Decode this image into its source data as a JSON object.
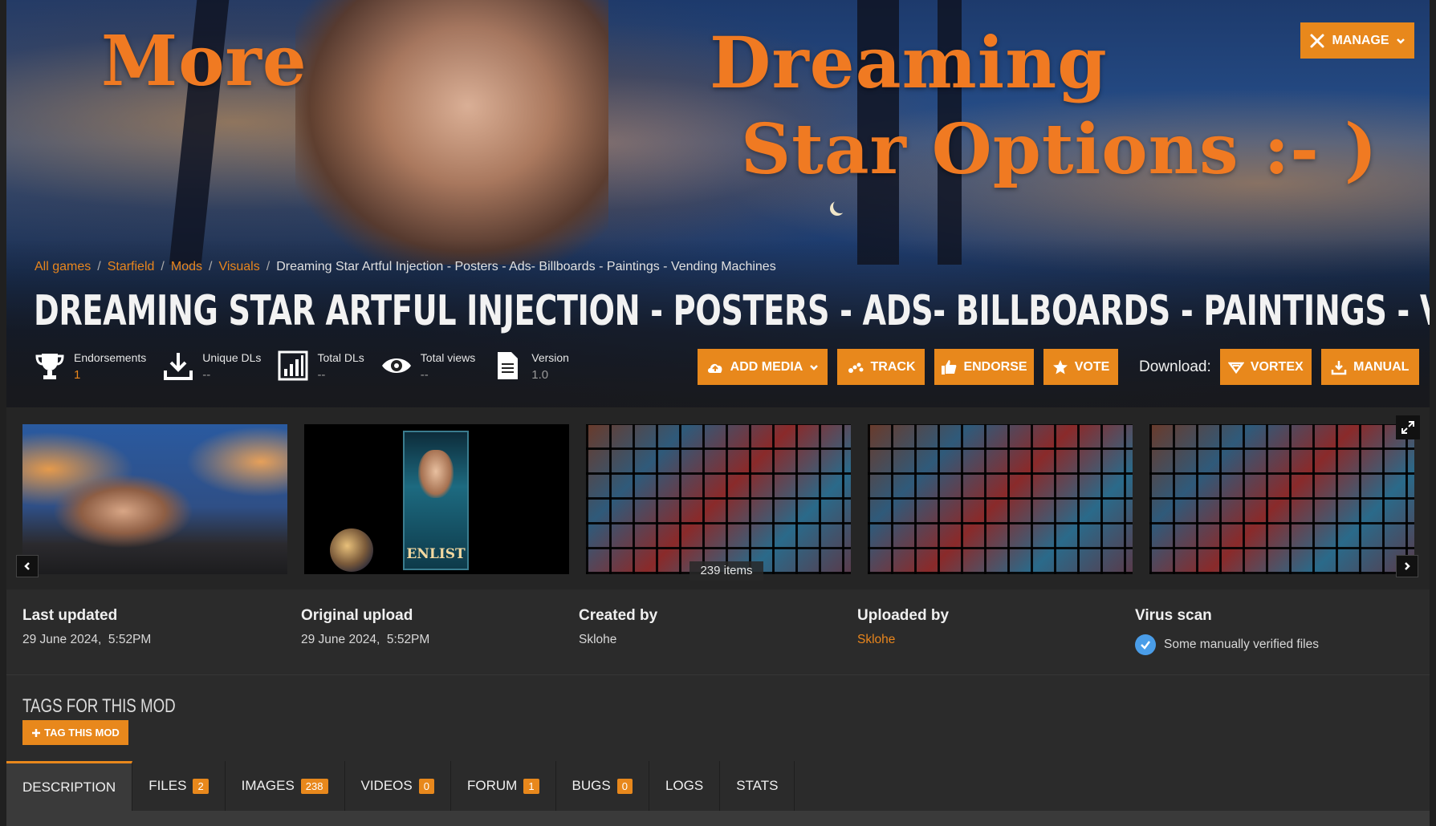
{
  "banner": {
    "line1": "More",
    "line2": "Dreaming",
    "line3": "Star Options :- )"
  },
  "manage_label": "MANAGE",
  "breadcrumb": {
    "items": [
      "All games",
      "Starfield",
      "Mods",
      "Visuals"
    ],
    "separator": "/",
    "current": "Dreaming Star Artful Injection - Posters - Ads- Billboards - Paintings - Vending Machines"
  },
  "title": "DREAMING STAR ARTFUL INJECTION - POSTERS - ADS- BILLBOARDS - PAINTINGS - VENDING MACHINES",
  "stats": [
    {
      "icon": "trophy-icon",
      "label": "Endorsements",
      "value": "1"
    },
    {
      "icon": "download-icon",
      "label": "Unique DLs",
      "value": "--"
    },
    {
      "icon": "bar-chart-icon",
      "label": "Total DLs",
      "value": "--"
    },
    {
      "icon": "eye-icon",
      "label": "Total views",
      "value": "--"
    },
    {
      "icon": "document-icon",
      "label": "Version",
      "value": "1.0"
    }
  ],
  "actions": {
    "add_media": "ADD MEDIA",
    "track": "TRACK",
    "endorse": "ENDORSE",
    "vote": "VOTE",
    "download_label": "Download:",
    "vortex": "VORTEX",
    "manual": "MANUAL"
  },
  "gallery": {
    "thumb2_caption": "ENLIST",
    "items_count": "239 items"
  },
  "info": {
    "last_updated": {
      "heading": "Last updated",
      "date": "29 June 2024,",
      "time": "5:52PM"
    },
    "original_upload": {
      "heading": "Original upload",
      "date": "29 June 2024,",
      "time": "5:52PM"
    },
    "created_by": {
      "heading": "Created by",
      "value": "Sklohe"
    },
    "uploaded_by": {
      "heading": "Uploaded by",
      "value": "Sklohe"
    },
    "virus_scan": {
      "heading": "Virus scan",
      "value": "Some manually verified files"
    }
  },
  "tags": {
    "title": "TAGS FOR THIS MOD",
    "button": "TAG THIS MOD"
  },
  "tabs": [
    {
      "label": "DESCRIPTION",
      "badge": null,
      "active": true
    },
    {
      "label": "FILES",
      "badge": "2"
    },
    {
      "label": "IMAGES",
      "badge": "238"
    },
    {
      "label": "VIDEOS",
      "badge": "0"
    },
    {
      "label": "FORUM",
      "badge": "1"
    },
    {
      "label": "BUGS",
      "badge": "0"
    },
    {
      "label": "LOGS",
      "badge": null
    },
    {
      "label": "STATS",
      "badge": null
    }
  ],
  "colors": {
    "accent": "#e8881c",
    "link": "#e9861d",
    "background": "#2b2b2b",
    "verified": "#4a9de8"
  }
}
